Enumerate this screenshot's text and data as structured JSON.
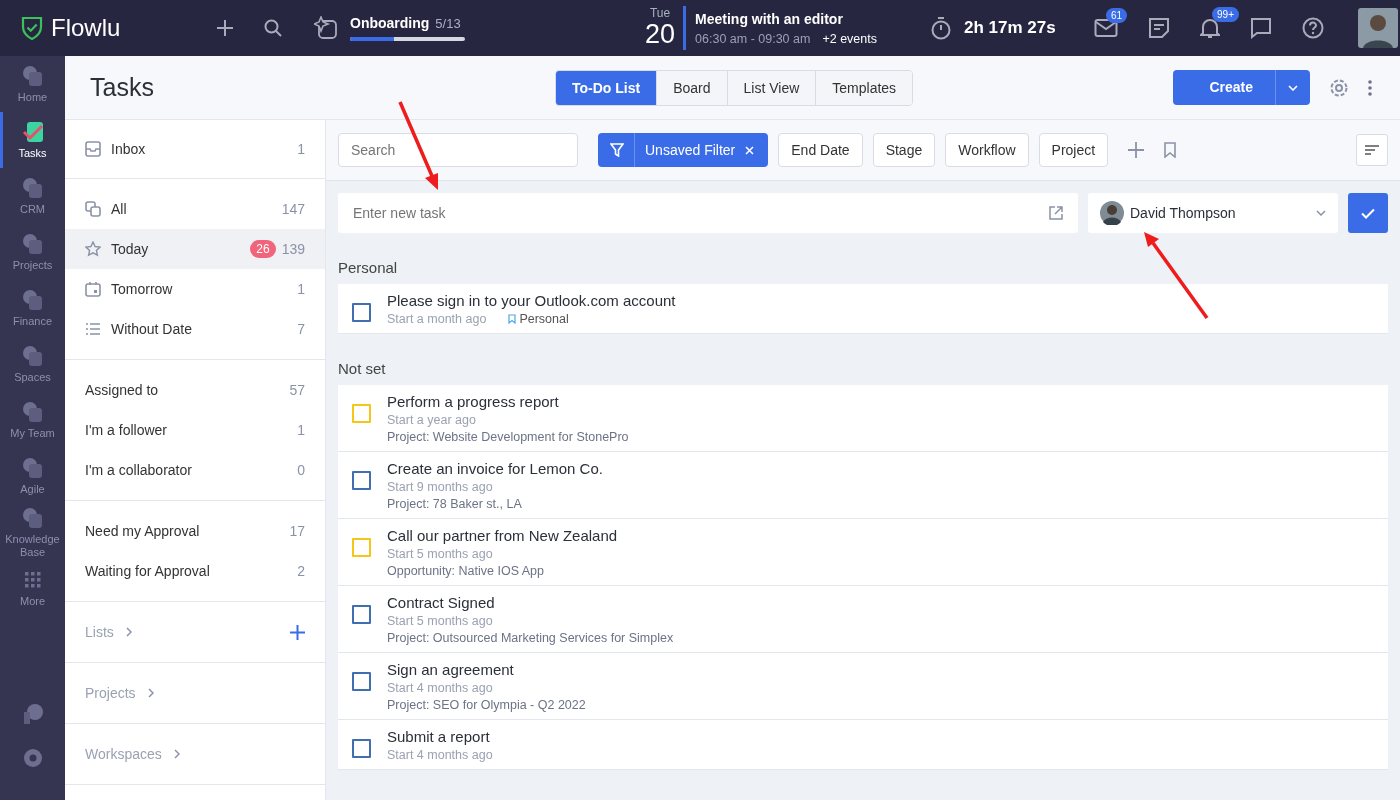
{
  "topbar": {
    "logo": "Flowlu",
    "onboarding": {
      "label": "Onboarding",
      "count": "5/13",
      "level": 0.38
    },
    "date": {
      "weekday": "Tue",
      "day": "20"
    },
    "meeting": {
      "title": "Meeting with an editor",
      "time": "06:30 am - 09:30 am",
      "more": "+2 events"
    },
    "timer": "2h 17m 27s",
    "mail_badge": "61",
    "notifications_badge": "99+"
  },
  "rail": [
    {
      "label": "Home",
      "selected": false
    },
    {
      "label": "Tasks",
      "selected": true
    },
    {
      "label": "CRM",
      "selected": false
    },
    {
      "label": "Projects",
      "selected": false
    },
    {
      "label": "Finance",
      "selected": false
    },
    {
      "label": "Spaces",
      "selected": false
    },
    {
      "label": "My Team",
      "selected": false
    },
    {
      "label": "Agile",
      "selected": false
    },
    {
      "label": "Knowledge Base",
      "selected": false
    },
    {
      "label": "More",
      "selected": false
    }
  ],
  "header": {
    "title": "Tasks",
    "tabs": [
      {
        "label": "To-Do List",
        "selected": true
      },
      {
        "label": "Board",
        "selected": false
      },
      {
        "label": "List View",
        "selected": false
      },
      {
        "label": "Templates",
        "selected": false
      }
    ],
    "create": "Create"
  },
  "sidebar": {
    "groups": [
      [
        {
          "label": "Inbox",
          "count": "1",
          "selected": false
        }
      ],
      [
        {
          "label": "All",
          "count": "147",
          "selected": false
        },
        {
          "label": "Today",
          "badge": "26",
          "count": "139",
          "selected": true
        },
        {
          "label": "Tomorrow",
          "count": "1",
          "selected": false
        },
        {
          "label": "Without Date",
          "count": "7",
          "selected": false
        }
      ],
      [
        {
          "label": "Assigned to",
          "count": "57",
          "selected": false
        },
        {
          "label": "I'm a follower",
          "count": "1",
          "selected": false
        },
        {
          "label": "I'm a collaborator",
          "count": "0",
          "selected": false
        }
      ],
      [
        {
          "label": "Need my Approval",
          "count": "17",
          "selected": false
        },
        {
          "label": "Waiting for Approval",
          "count": "2",
          "selected": false
        }
      ]
    ],
    "sections": [
      {
        "label": "Lists",
        "addable": true
      },
      {
        "label": "Projects",
        "addable": false
      },
      {
        "label": "Workspaces",
        "addable": false
      }
    ]
  },
  "filters": {
    "search": {
      "placeholder": "Search"
    },
    "active_filter": "Unsaved Filter",
    "buttons": [
      "End Date",
      "Stage",
      "Workflow",
      "Project"
    ]
  },
  "new_task": {
    "placeholder": "Enter new task",
    "assignee": "David Thompson"
  },
  "task_groups": [
    {
      "title": "Personal",
      "tasks": [
        {
          "title": "Please sign in to your Outlook.com account",
          "start": "Start a month ago",
          "tag": "Personal",
          "color": "#3f6fb0"
        }
      ]
    },
    {
      "title": "Not set",
      "tasks": [
        {
          "title": "Perform a progress report",
          "start": "Start a year ago",
          "context": "Project: Website Development for StonePro",
          "color": "#f5c518"
        },
        {
          "title": "Create an invoice for Lemon Co.",
          "start": "Start 9 months ago",
          "context": "Project: 78 Baker st., LA",
          "color": "#3f6fb0"
        },
        {
          "title": "Call our partner from New Zealand",
          "start": "Start 5 months ago",
          "context": "Opportunity: Native IOS App",
          "color": "#f5c518"
        },
        {
          "title": "Contract Signed",
          "start": "Start 5 months ago",
          "context": "Project: Outsourced Marketing Services for Simplex",
          "color": "#3f6fb0"
        },
        {
          "title": "Sign an agreement",
          "start": "Start 4 months ago",
          "context": "Project: SEO for Olympia - Q2 2022",
          "color": "#3f6fb0"
        },
        {
          "title": "Submit a report",
          "start": "Start 4 months ago",
          "color": "#3f6fb0"
        }
      ]
    }
  ]
}
